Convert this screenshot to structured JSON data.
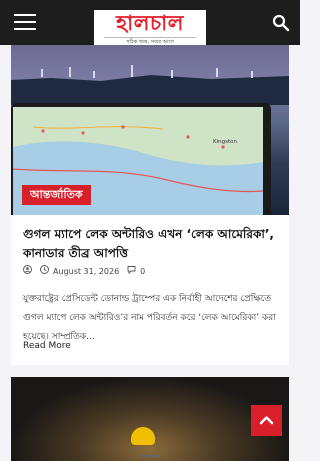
{
  "header": {
    "logo_text": "হালচাল",
    "logo_tagline": "সঠিক খবর, সবার আগে",
    "menu_icon": "hamburger-icon",
    "search_icon": "search-icon"
  },
  "article": {
    "category": "আন্তর্জাতিক",
    "title": "গুগল ম্যাপে লেক অন্টারিও এখন ‘লেক আমেরিকা’, কানাডার তীব্র আপত্তি",
    "date": "August 31, 2026",
    "comments": "0",
    "excerpt": "যুক্তরাষ্ট্রের প্রেসিডেন্ট ডোনাল্ড ট্রাম্পের এক নির্বাহী আদেশের প্রেক্ষিতে গুগল ম্যাপে লেক অন্টারিও’র নাম পরিবর্তন করে ‘লেক আমেরিকা’ করা হয়েছে। সাম্প্রতিক...",
    "read_more": "Read More"
  },
  "map_labels": {
    "city": "Kingston"
  },
  "colors": {
    "accent": "#d8202b",
    "topbar": "#1d1d1d"
  }
}
